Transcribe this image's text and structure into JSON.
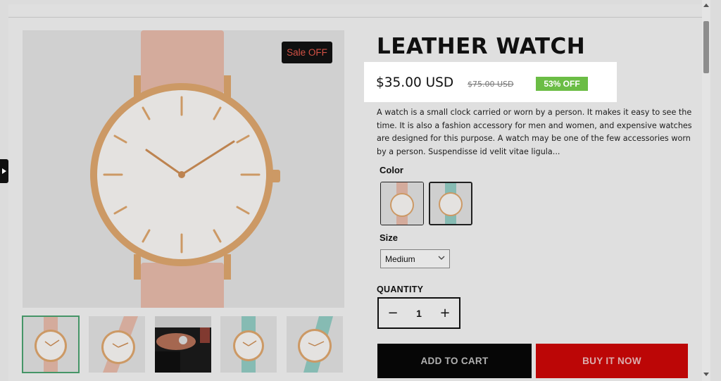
{
  "product": {
    "title": "LEATHER WATCH",
    "price": "$35.00 USD",
    "compare_price": "$75.00 USD",
    "discount_badge": "53% OFF",
    "sale_badge": "Sale OFF",
    "description": "A watch is a small clock carried or worn by a person. It makes it easy to see the time. It is also a fashion accessory for men and women, and expensive watches are designed for this purpose. A watch may be one of the few accessories worn by a person. Suspendisse id velit vitae ligula..."
  },
  "options": {
    "color_label": "Color",
    "size_label": "Size",
    "size_value": "Medium"
  },
  "quantity": {
    "label": "QUANTITY",
    "value": "1",
    "minus": "−",
    "plus": "+"
  },
  "actions": {
    "add_to_cart": "ADD TO CART",
    "buy_now": "BUY IT NOW"
  },
  "colors": {
    "strap_pink": "#e2b6a6",
    "strap_teal": "#8fc7bf",
    "gold": "#d9a36c",
    "discount_green": "#6bbd45",
    "buy_red": "#c80707",
    "sale_text": "#e0574a"
  }
}
